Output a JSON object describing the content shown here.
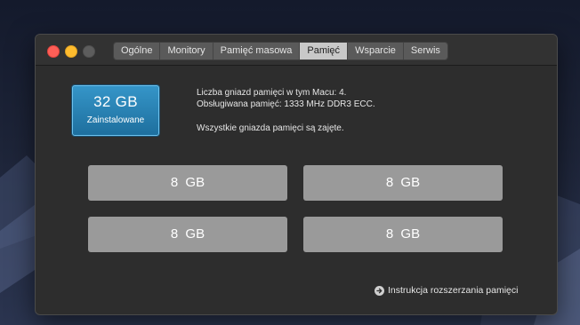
{
  "window": {
    "tabs": [
      {
        "label": "Ogólne",
        "active": false
      },
      {
        "label": "Monitory",
        "active": false
      },
      {
        "label": "Pamięć masowa",
        "active": false
      },
      {
        "label": "Pamięć",
        "active": true
      },
      {
        "label": "Wsparcie",
        "active": false
      },
      {
        "label": "Serwis",
        "active": false
      }
    ]
  },
  "memory": {
    "installed_size": "32 GB",
    "installed_label": "Zainstalowane",
    "slot_count_text": "Liczba gniazd pamięci w tym Macu: 4.",
    "supported_memory_text": "Obsługiwana pamięć: 1333 MHz DDR3 ECC.",
    "slots_status_text": "Wszystkie gniazda pamięci są zajęte.",
    "slots": [
      {
        "size": "8 GB"
      },
      {
        "size": "8 GB"
      },
      {
        "size": "8 GB"
      },
      {
        "size": "8 GB"
      }
    ],
    "help_link_label": "Instrukcja rozszerzania pamięci"
  },
  "colors": {
    "accent_blue": "#2a84b8",
    "slot_gray": "#9a9a9a",
    "active_tab": "#c8c8c8",
    "traffic_close": "#fe5f57",
    "traffic_minimize": "#febc2e",
    "traffic_zoom_disabled": "#5d5d5d"
  },
  "icons": {
    "help_link": "arrow-right-circle-icon"
  }
}
